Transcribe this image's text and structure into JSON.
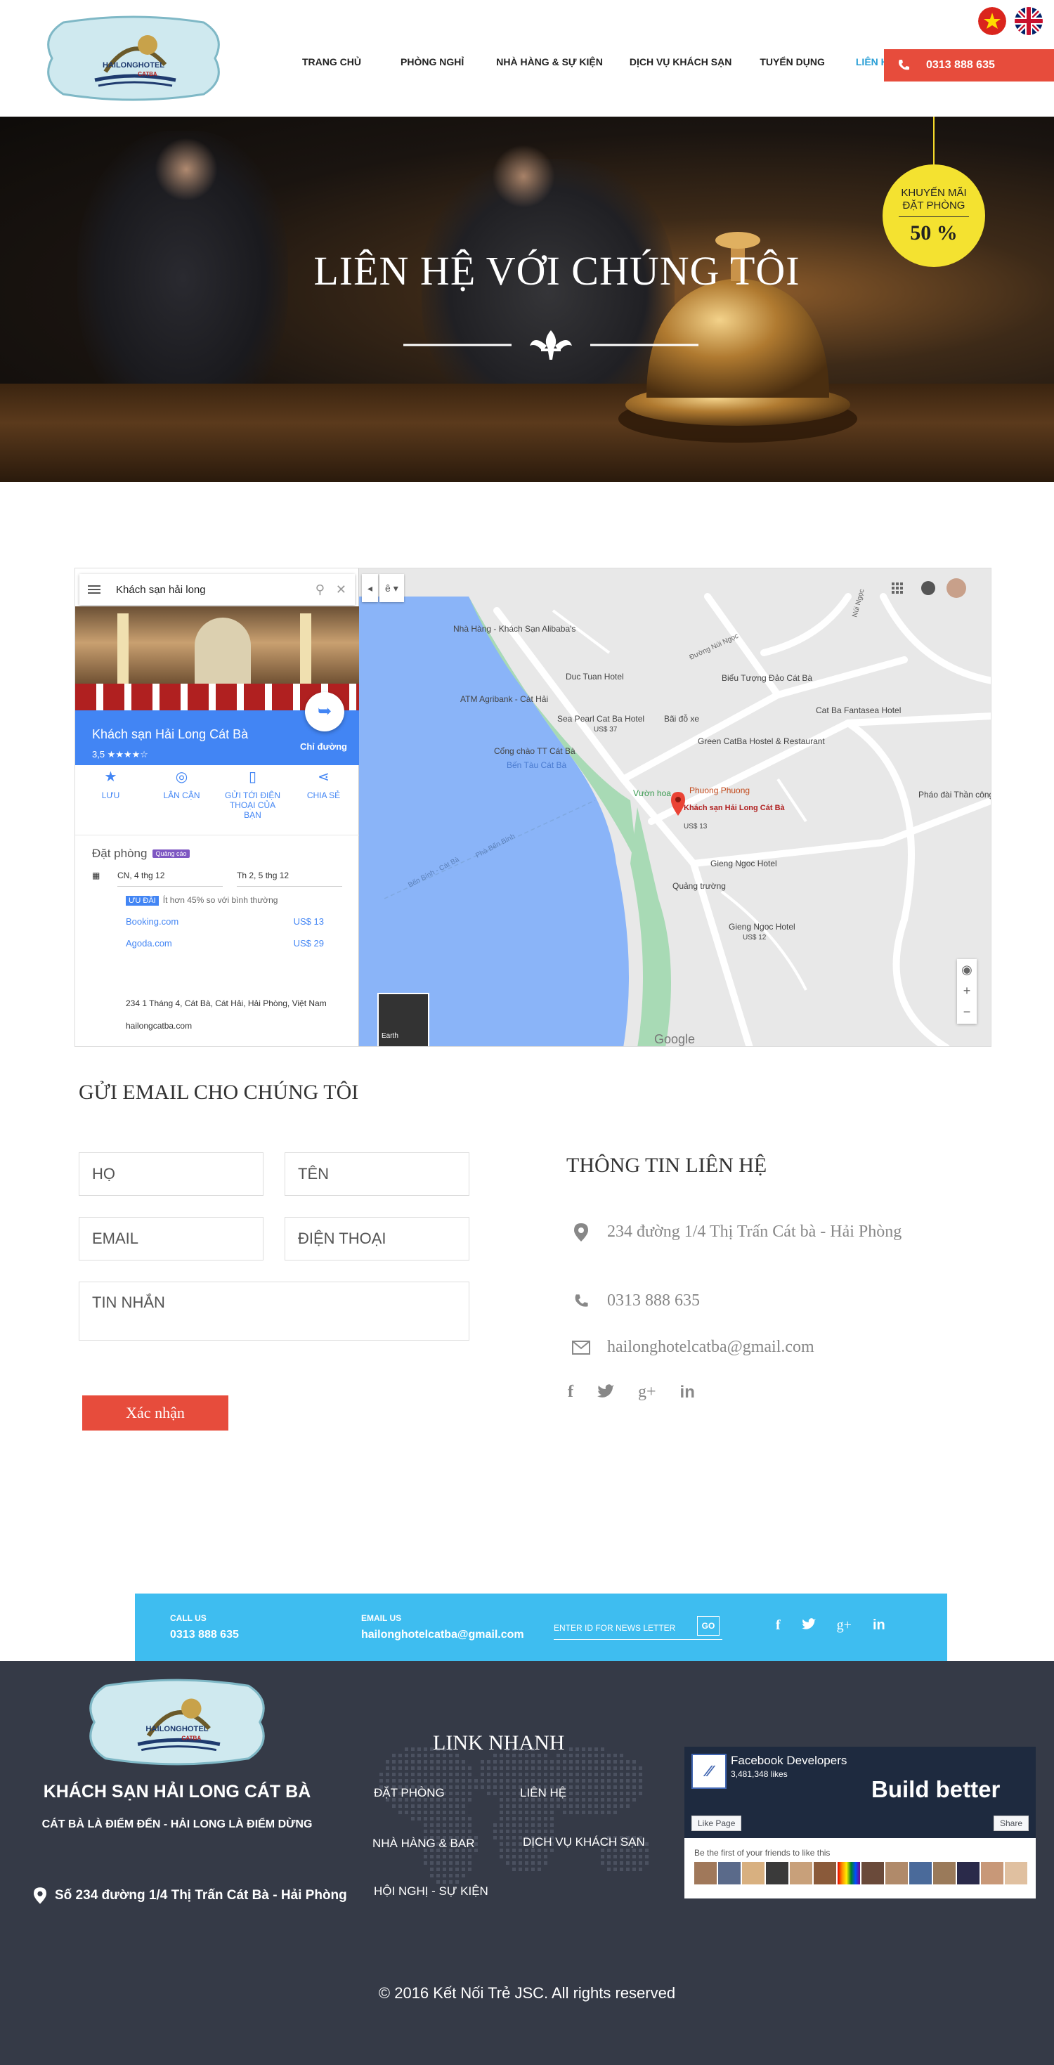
{
  "header": {
    "logo_text_top": "HAILONGHOTEL",
    "logo_text_bottom": "CATBA",
    "nav": [
      {
        "label": "TRANG CHỦ",
        "active": false
      },
      {
        "label": "PHÒNG NGHỈ",
        "active": false
      },
      {
        "label": "NHÀ HÀNG & SỰ KIỆN",
        "active": false
      },
      {
        "label": "DỊCH VỤ KHÁCH SẠN",
        "active": false
      },
      {
        "label": "TUYỂN DỤNG",
        "active": false
      },
      {
        "label": "LIÊN HỆ",
        "active": true
      }
    ],
    "phone": "0313 888 635",
    "flags": [
      "vietnam-flag-icon",
      "uk-flag-icon"
    ]
  },
  "hero": {
    "title": "LIÊN HỆ VỚI CHÚNG TÔI",
    "promo_line1": "KHUYẾN MÃI",
    "promo_line2": "ĐẶT PHÒNG",
    "promo_value": "50 %"
  },
  "map": {
    "search": "Khách sạn hải long",
    "place_name": "Khách sạn Hải Long Cát Bà",
    "rating": "3,5 ★★★★☆",
    "directions_label": "Chỉ đường",
    "actions": [
      {
        "icon": "star-icon",
        "label": "LƯU"
      },
      {
        "icon": "nearby-icon",
        "label": "LÂN CẬN"
      },
      {
        "icon": "send-to-phone-icon",
        "label": "GỬI TỚI ĐIỆN THOẠI CỦA BẠN"
      },
      {
        "icon": "share-icon",
        "label": "CHIA SẺ"
      }
    ],
    "booking_title": "Đặt phòng",
    "booking_ad": "Quảng cáo",
    "checkin": "CN, 4 thg 12",
    "checkout": "Th 2, 5 thg 12",
    "deal_badge": "ƯU ĐÃI",
    "deal_text": "Ít hơn 45% so với bình thường",
    "offers": [
      {
        "site": "Booking.com",
        "price": "US$ 13"
      },
      {
        "site": "Agoda.com",
        "price": "US$ 29"
      }
    ],
    "address": "234 1 Tháng 4, Cát Bà, Cát Hải, Hải Phòng, Việt Nam",
    "website": "hailongcatba.com",
    "earth_label": "Earth",
    "google_label": "Google",
    "labels": [
      {
        "name": "Nhà Hàng - Khách Sạn Alibaba's"
      },
      {
        "name": "Duc Tuan Hotel"
      },
      {
        "name": "Biểu Tượng Đảo Cát Bà"
      },
      {
        "name": "ATM Agribank - Cát Hải"
      },
      {
        "name": "Sea Pearl Cat Ba Hotel"
      },
      {
        "name": "Cat Ba Fantasea Hotel"
      },
      {
        "name": "Bãi đỗ xe"
      },
      {
        "name": "Cổng chào TT Cát Bà"
      },
      {
        "name": "Green CatBa Hostel & Restaurant"
      },
      {
        "name": "Bến Tàu Cát Bà"
      },
      {
        "name": "Vườn hoa"
      },
      {
        "name": "Phuong Phuong"
      },
      {
        "name": "Khách sạn Hải Long Cát Bà"
      },
      {
        "name": "Pháo đài Thần công"
      },
      {
        "name": "Gieng Ngoc Hotel"
      },
      {
        "name": "Quảng trường"
      },
      {
        "name": "Gieng Ngoc Hotel"
      },
      {
        "name": "Núi Ngọc"
      },
      {
        "name": "Đường Núi Ngọc"
      },
      {
        "name": "Bến Bính - Cát Bà"
      },
      {
        "name": "Phà Bến Bính"
      }
    ],
    "prices": [
      "US$ 37",
      "US$ 13",
      "US$ 12"
    ]
  },
  "form": {
    "title": "GỬI EMAIL CHO CHÚNG TÔI",
    "ho": "HỌ",
    "ten": "TÊN",
    "email": "EMAIL",
    "dienthoai": "ĐIỆN THOẠI",
    "tinnhan": "TIN NHẮN",
    "submit": "Xác nhận"
  },
  "contact": {
    "title": "THÔNG TIN LIÊN HỆ",
    "address": "234 đường 1/4 Thị Trấn Cát bà - Hải Phòng",
    "phone": "0313 888 635",
    "email": "hailonghotelcatba@gmail.com"
  },
  "newsletter": {
    "call_label": "CALL US",
    "call_value": "0313 888 635",
    "email_label": "EMAIL US",
    "email_value": "hailonghotelcatba@gmail.com",
    "input_placeholder": "ENTER ID FOR NEWS LETTER",
    "go": "GO"
  },
  "footer": {
    "hotel_name": "KHÁCH SẠN HẢI LONG CÁT BÀ",
    "slogan": "CÁT BÀ LÀ ĐIỂM ĐẾN - HẢI LONG LÀ ĐIỂM DỪNG",
    "address": "Số 234 đường 1/4 Thị Trấn Cát Bà - Hải Phòng",
    "link_title": "LINK NHANH",
    "links": [
      "ĐẶT PHÒNG",
      "LIÊN HỆ",
      "NHÀ HÀNG & BAR",
      "DỊCH VỤ KHÁCH SẠN",
      "HỘI NGHỊ - SỰ KIỆN"
    ],
    "fb_name": "Facebook Developers",
    "fb_likes": "3,481,348 likes",
    "fb_build": "Build better",
    "fb_like": "Like Page",
    "fb_share": "Share",
    "fb_first": "Be the first of your friends to like this",
    "copyright": "© 2016 Kết Nối Trẻ JSC. All rights reserved"
  },
  "colors": {
    "accent_red": "#e74c3c",
    "accent_blue": "#3ebdf0",
    "nav_active": "#2a9fd6",
    "promo_yellow": "#f4e230",
    "footer_bg": "#353a47"
  }
}
